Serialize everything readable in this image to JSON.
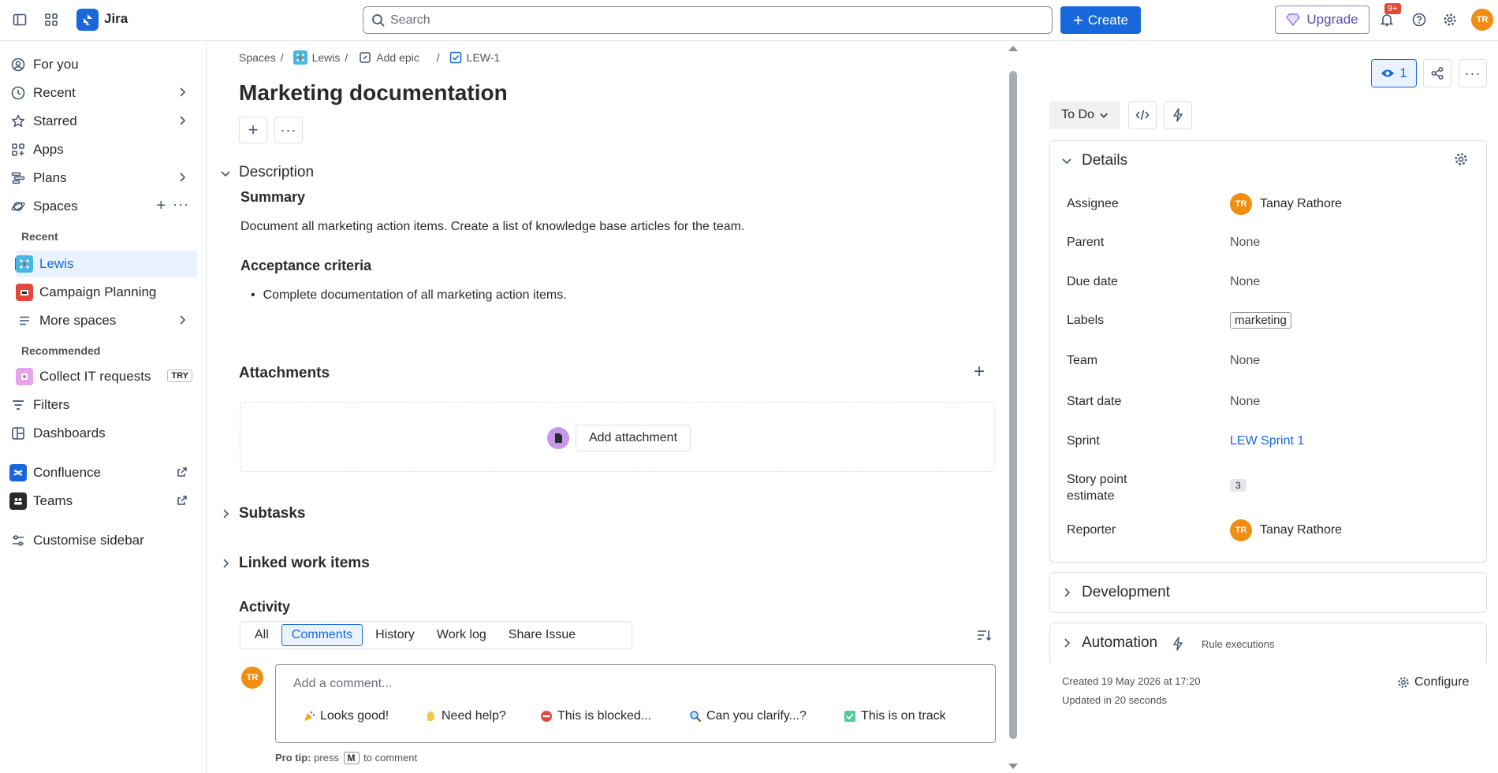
{
  "topbar": {
    "app_name": "Jira",
    "search_placeholder": "Search",
    "create_label": "Create",
    "upgrade_label": "Upgrade",
    "notifications_badge": "9+",
    "user_initials": "TR"
  },
  "sidebar": {
    "items": [
      {
        "label": "For you"
      },
      {
        "label": "Recent"
      },
      {
        "label": "Starred"
      },
      {
        "label": "Apps"
      },
      {
        "label": "Plans"
      },
      {
        "label": "Spaces"
      }
    ],
    "recent_heading": "Recent",
    "recent_spaces": [
      {
        "label": "Lewis"
      },
      {
        "label": "Campaign Planning"
      },
      {
        "label": "More spaces"
      }
    ],
    "recommended_heading": "Recommended",
    "recommended": {
      "label": "Collect IT requests",
      "badge": "TRY"
    },
    "bottom": [
      {
        "label": "Filters"
      },
      {
        "label": "Dashboards"
      },
      {
        "label": "Confluence"
      },
      {
        "label": "Teams"
      },
      {
        "label": "Customise sidebar"
      }
    ]
  },
  "breadcrumb": {
    "spaces": "Spaces",
    "project": "Lewis",
    "epic": "Add epic",
    "issue_key": "LEW-1"
  },
  "issue": {
    "title": "Marketing documentation",
    "description_heading": "Description",
    "summary_heading": "Summary",
    "summary_text": "Document all marketing action items. Create a list of knowledge base articles for the team.",
    "acceptance_heading": "Acceptance criteria",
    "acceptance_items": [
      "Complete documentation of all marketing action items."
    ],
    "attachments_heading": "Attachments",
    "add_attachment_label": "Add attachment",
    "subtasks_heading": "Subtasks",
    "linked_heading": "Linked work items",
    "activity_heading": "Activity"
  },
  "activity": {
    "tabs": [
      "All",
      "Comments",
      "History",
      "Work log",
      "Share Issue"
    ],
    "active_tab": "Comments",
    "comment_placeholder": "Add a comment...",
    "quick_replies": [
      "Looks good!",
      "Need help?",
      "This is blocked...",
      "Can you clarify...?",
      "This is on track"
    ],
    "pro_tip_label": "Pro tip:",
    "pro_tip_press": "press",
    "pro_tip_key": "M",
    "pro_tip_suffix": "to comment",
    "user_initials": "TR"
  },
  "right_panel": {
    "watchers_count": "1",
    "status": "To Do",
    "details_heading": "Details",
    "fields": {
      "assignee_label": "Assignee",
      "assignee_value": "Tanay Rathore",
      "assignee_initials": "TR",
      "parent_label": "Parent",
      "parent_value": "None",
      "due_label": "Due date",
      "due_value": "None",
      "labels_label": "Labels",
      "labels_value": "marketing",
      "team_label": "Team",
      "team_value": "None",
      "start_label": "Start date",
      "start_value": "None",
      "sprint_label": "Sprint",
      "sprint_value": "LEW Sprint 1",
      "sp_label_line1": "Story point",
      "sp_label_line2": "estimate",
      "sp_value": "3",
      "reporter_label": "Reporter",
      "reporter_value": "Tanay Rathore",
      "reporter_initials": "TR"
    },
    "development_heading": "Development",
    "automation_heading": "Automation",
    "rule_executions": "Rule executions",
    "created_text": "Created 19 May 2026 at 17:20",
    "updated_text": "Updated in 20 seconds",
    "configure_label": "Configure"
  }
}
